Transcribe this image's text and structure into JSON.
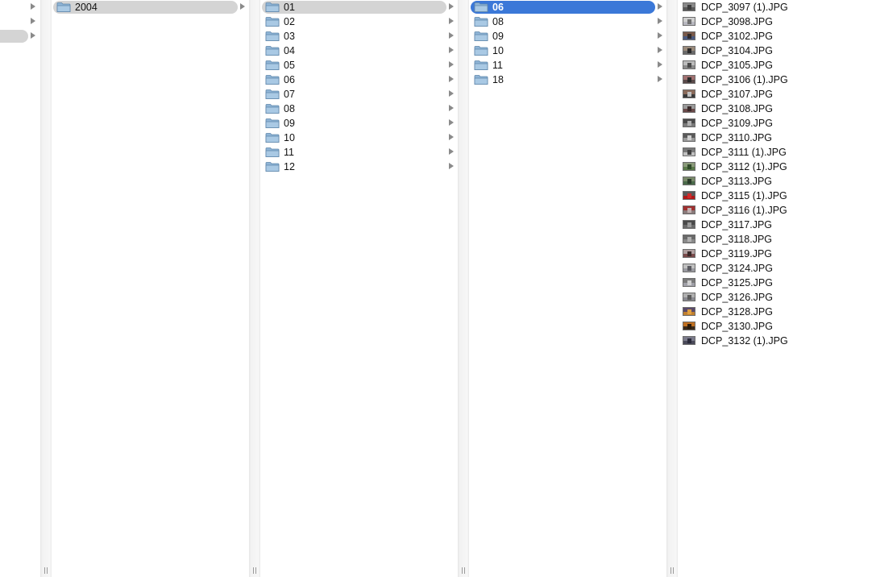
{
  "columns": [
    {
      "items": [
        {
          "label": "",
          "has_arrow": true,
          "selected": false
        },
        {
          "label": "",
          "has_arrow": true,
          "selected": false
        },
        {
          "label": "",
          "has_arrow": true,
          "selected": "inactive"
        }
      ]
    },
    {
      "items": [
        {
          "label": "2004",
          "has_arrow": true,
          "selected": "inactive"
        }
      ]
    },
    {
      "items": [
        {
          "label": "01",
          "has_arrow": true,
          "selected": "inactive"
        },
        {
          "label": "02",
          "has_arrow": true,
          "selected": false
        },
        {
          "label": "03",
          "has_arrow": true,
          "selected": false
        },
        {
          "label": "04",
          "has_arrow": true,
          "selected": false
        },
        {
          "label": "05",
          "has_arrow": true,
          "selected": false
        },
        {
          "label": "06",
          "has_arrow": true,
          "selected": false
        },
        {
          "label": "07",
          "has_arrow": true,
          "selected": false
        },
        {
          "label": "08",
          "has_arrow": true,
          "selected": false
        },
        {
          "label": "09",
          "has_arrow": true,
          "selected": false
        },
        {
          "label": "10",
          "has_arrow": true,
          "selected": false
        },
        {
          "label": "11",
          "has_arrow": true,
          "selected": false
        },
        {
          "label": "12",
          "has_arrow": true,
          "selected": false
        }
      ]
    },
    {
      "items": [
        {
          "label": "06",
          "has_arrow": true,
          "selected": "active"
        },
        {
          "label": "08",
          "has_arrow": true,
          "selected": false
        },
        {
          "label": "09",
          "has_arrow": true,
          "selected": false
        },
        {
          "label": "10",
          "has_arrow": true,
          "selected": false
        },
        {
          "label": "11",
          "has_arrow": true,
          "selected": false
        },
        {
          "label": "18",
          "has_arrow": true,
          "selected": false
        }
      ]
    },
    {
      "files": [
        {
          "label": "DCP_3097 (1).JPG",
          "colors": [
            "#5a5a5a",
            "#8a8a8a",
            "#3d3d3d"
          ]
        },
        {
          "label": "DCP_3098.JPG",
          "colors": [
            "#b8b8c0",
            "#d0d0d0",
            "#707070"
          ]
        },
        {
          "label": "DCP_3102.JPG",
          "colors": [
            "#4a5a80",
            "#7a5a4a",
            "#302a2a"
          ]
        },
        {
          "label": "DCP_3104.JPG",
          "colors": [
            "#6a6a6a",
            "#9a8a7a",
            "#2a2a2a"
          ]
        },
        {
          "label": "DCP_3105.JPG",
          "colors": [
            "#8a8a8a",
            "#bcbcbc",
            "#4a4a4a"
          ]
        },
        {
          "label": "DCP_3106 (1).JPG",
          "colors": [
            "#5a4a4a",
            "#a07070",
            "#2a2a2a"
          ]
        },
        {
          "label": "DCP_3107.JPG",
          "colors": [
            "#3a3a3a",
            "#8a6a5a",
            "#c0c0c0"
          ]
        },
        {
          "label": "DCP_3108.JPG",
          "colors": [
            "#6a4a4a",
            "#9a9a9a",
            "#3a2a2a"
          ]
        },
        {
          "label": "DCP_3109.JPG",
          "colors": [
            "#7a7a7a",
            "#4a4a4a",
            "#b0b0b0"
          ]
        },
        {
          "label": "DCP_3110.JPG",
          "colors": [
            "#9a9a9a",
            "#5a5a5a",
            "#d0d0d0"
          ]
        },
        {
          "label": "DCP_3111 (1).JPG",
          "colors": [
            "#c0c0c0",
            "#7a7a7a",
            "#404040"
          ]
        },
        {
          "label": "DCP_3112 (1).JPG",
          "colors": [
            "#5a7a4a",
            "#8a9a7a",
            "#304a2a"
          ]
        },
        {
          "label": "DCP_3113.JPG",
          "colors": [
            "#4a6a4a",
            "#7a8a6a",
            "#2a3a2a"
          ]
        },
        {
          "label": "DCP_3115 (1).JPG",
          "colors": [
            "#b01818",
            "#5a5a5a",
            "#d02a2a"
          ]
        },
        {
          "label": "DCP_3116 (1).JPG",
          "colors": [
            "#8a7a7a",
            "#a03030",
            "#c0b0b0"
          ]
        },
        {
          "label": "DCP_3117.JPG",
          "colors": [
            "#6a6a6a",
            "#4a4a4a",
            "#9a9a9a"
          ]
        },
        {
          "label": "DCP_3118.JPG",
          "colors": [
            "#8a8a8a",
            "#6a6a6a",
            "#b0b0b0"
          ]
        },
        {
          "label": "DCP_3119.JPG",
          "colors": [
            "#7a4a4a",
            "#b0a0a0",
            "#3a2a2a"
          ]
        },
        {
          "label": "DCP_3124.JPG",
          "colors": [
            "#9a9aa0",
            "#c0c0c0",
            "#5a5a60"
          ]
        },
        {
          "label": "DCP_3125.JPG",
          "colors": [
            "#a0a0a8",
            "#7a7a7a",
            "#d0d0d0"
          ]
        },
        {
          "label": "DCP_3126.JPG",
          "colors": [
            "#8a8a90",
            "#b0b0b0",
            "#5a5a5a"
          ]
        },
        {
          "label": "DCP_3128.JPG",
          "colors": [
            "#c08030",
            "#5a4a6a",
            "#e0a040"
          ]
        },
        {
          "label": "DCP_3130.JPG",
          "colors": [
            "#3a2a1a",
            "#c07020",
            "#2a1a0a"
          ]
        },
        {
          "label": "DCP_3132 (1).JPG",
          "colors": [
            "#4a4a5a",
            "#7a7a8a",
            "#2a2a3a"
          ]
        }
      ]
    }
  ],
  "colors": {
    "selection_active": "#3b78d8",
    "selection_inactive": "#d4d4d4",
    "arrow": "#8a8a8a",
    "folder_fill": "#a9c9e4",
    "folder_stroke": "#5f86aa"
  }
}
